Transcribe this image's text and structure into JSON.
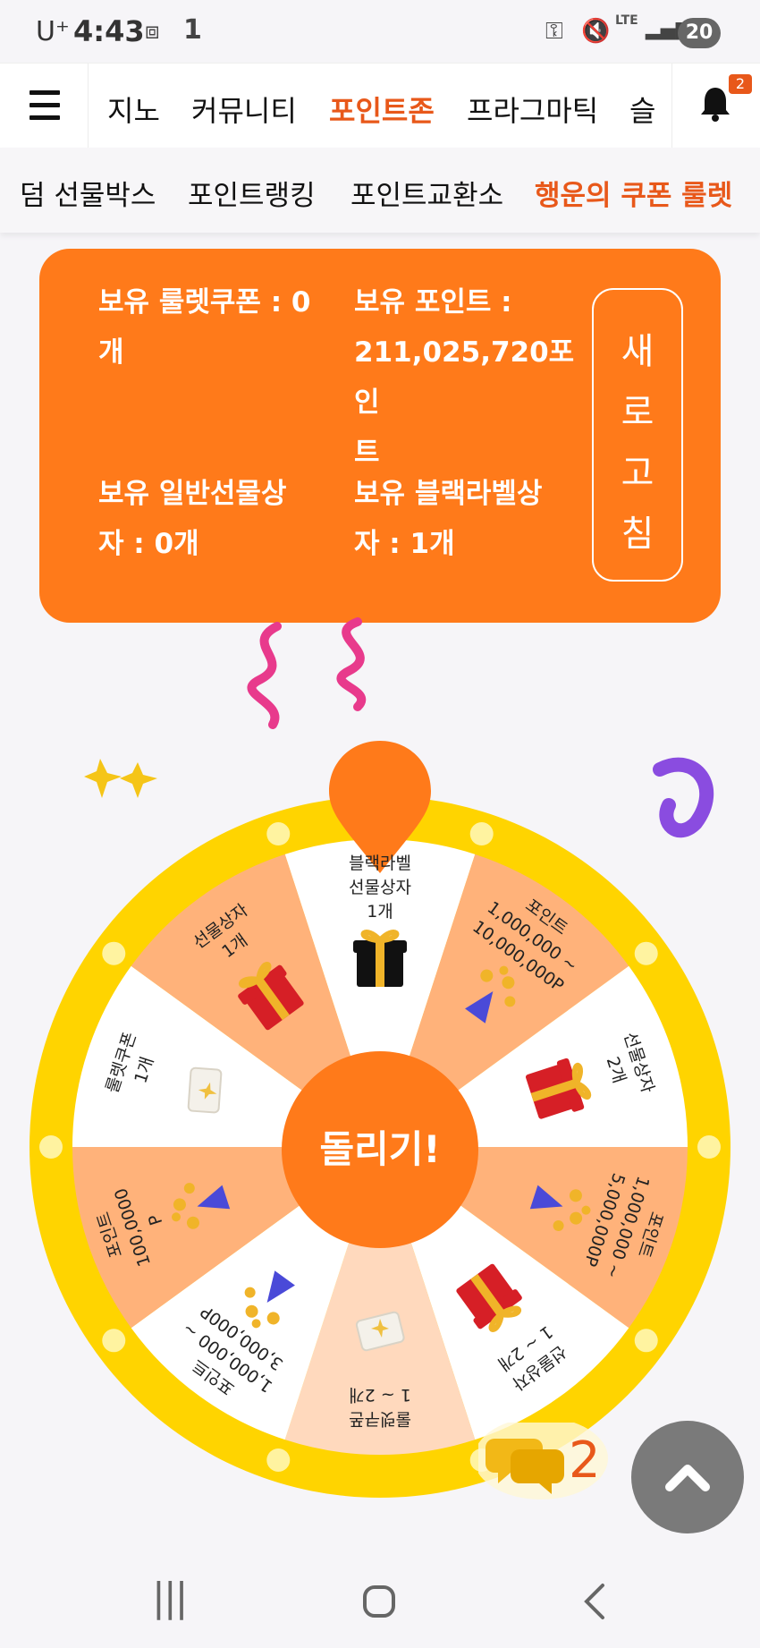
{
  "status": {
    "carrier": "U⁺",
    "time": "4:43",
    "extra": "1",
    "network": "LTE",
    "battery": "20"
  },
  "nav": {
    "tabs": [
      "지노",
      "커뮤니티",
      "포인트존",
      "프라그마틱",
      "슬"
    ],
    "active_tab": "포인트존",
    "notification_count": "2"
  },
  "subnav": {
    "tabs": [
      "덤 선물박스",
      "포인트랭킹",
      "포인트교환소",
      "행운의 쿠폰 룰렛"
    ],
    "active_tab": "행운의 쿠폰 룰렛"
  },
  "card": {
    "coupons_line1": "보유 룰렛쿠폰 : 0",
    "coupons_line2": "개",
    "points_line1": "보유 포인트 :",
    "points_line2": "211,025,720포인",
    "points_line3": "트",
    "normal_box_line1": "보유 일반선물상",
    "normal_box_line2": "자 : 0개",
    "black_box_line1": "보유 블랙라벨상",
    "black_box_line2": "자 : 1개",
    "refresh_chars": [
      "새",
      "로",
      "고",
      "침"
    ]
  },
  "wheel": {
    "spin_label": "돌리기!",
    "segments": [
      {
        "lines": [
          "블랙라벨",
          "선물상자",
          "1개"
        ],
        "icon": "black-gift-box-icon"
      },
      {
        "lines": [
          "포인트",
          "1,000,000 ~",
          "10,000,000P"
        ],
        "icon": "coin-popper-icon"
      },
      {
        "lines": [
          "선물상자",
          "2개"
        ],
        "icon": "red-gift-box-icon"
      },
      {
        "lines": [
          "포인트",
          "1,000,000 ~",
          "5,000,000P"
        ],
        "icon": "coin-popper-icon"
      },
      {
        "lines": [
          "선물상자",
          "1 ~ 2개"
        ],
        "icon": "red-gift-box-icon"
      },
      {
        "lines": [
          "룰렛쿠폰",
          "1 ~ 2개"
        ],
        "icon": "coupon-ticket-icon"
      },
      {
        "lines": [
          "포인트",
          "1,000,000 ~",
          "3,000,000P"
        ],
        "icon": "coin-popper-icon"
      },
      {
        "lines": [
          "포인트",
          "100,0000",
          "P"
        ],
        "icon": "coin-popper-icon"
      },
      {
        "lines": [
          "룰렛쿠폰",
          "1개"
        ],
        "icon": "coupon-ticket-icon"
      },
      {
        "lines": [
          "선물상자",
          "1개"
        ],
        "icon": "red-gift-box-icon"
      }
    ]
  },
  "chat": {
    "count": "2"
  },
  "colors": {
    "accent": "#ff7a1a",
    "active_text": "#e8581a",
    "wheel_rim": "#ffd400",
    "segment_light": "#ffb27a",
    "segment_pale": "#ffd9bd"
  }
}
